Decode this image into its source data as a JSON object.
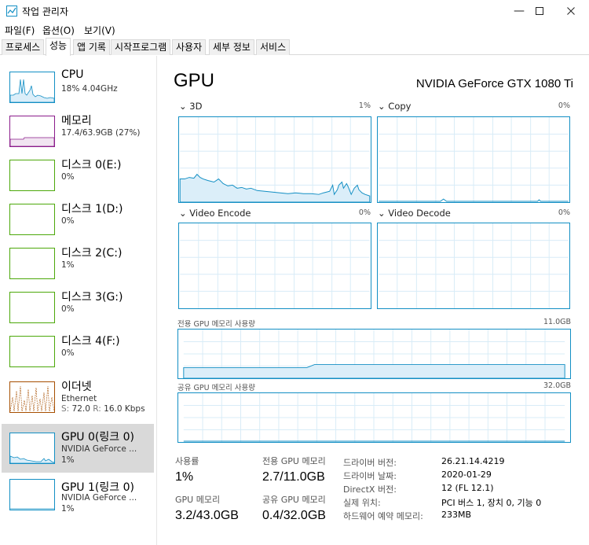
{
  "window": {
    "title": "작업 관리자"
  },
  "menu": [
    "파일(F)",
    "옵션(O)",
    "보기(V)"
  ],
  "tabs": [
    "프로세스",
    "성능",
    "앱 기록",
    "시작프로그램",
    "사용자",
    "세부 정보",
    "서비스"
  ],
  "sidebar": [
    {
      "name": "CPU",
      "sub": "18% 4.04GHz",
      "color": "#138fc4"
    },
    {
      "name": "메모리",
      "sub": "17.4/63.9GB (27%)",
      "color": "#8b1c8b"
    },
    {
      "name": "디스크 0(E:)",
      "sub": "0%",
      "color": "#4ca80a"
    },
    {
      "name": "디스크 1(D:)",
      "sub": "0%",
      "color": "#4ca80a"
    },
    {
      "name": "디스크 2(C:)",
      "sub": "1%",
      "color": "#4ca80a"
    },
    {
      "name": "디스크 3(G:)",
      "sub": "0%",
      "color": "#4ca80a"
    },
    {
      "name": "디스크 4(F:)",
      "sub": "0%",
      "color": "#4ca80a"
    },
    {
      "name": "이더넷",
      "sub": "Ethernet",
      "sub2_s": "S:",
      "sub2_s_val": "72.0",
      "sub2_r": "R:",
      "sub2_r_val": "16.0 Kbps",
      "color": "#a74f01"
    },
    {
      "name": "GPU 0(링크 0)",
      "sub": "NVIDIA GeForce ...",
      "sub2": "1%",
      "color": "#138fc4"
    },
    {
      "name": "GPU 1(링크 0)",
      "sub": "NVIDIA GeForce ...",
      "sub2": "1%",
      "color": "#138fc4"
    }
  ],
  "main": {
    "title": "GPU",
    "model": "NVIDIA GeForce GTX 1080 Ti",
    "engines": [
      {
        "label": "3D",
        "pct": "1%"
      },
      {
        "label": "Copy",
        "pct": "0%"
      },
      {
        "label": "Video Encode",
        "pct": "0%"
      },
      {
        "label": "Video Decode",
        "pct": "0%"
      }
    ],
    "dedicated_label": "전용 GPU 메모리 사용량",
    "dedicated_max": "11.0GB",
    "shared_label": "공유 GPU 메모리 사용량",
    "shared_max": "32.0GB",
    "stats": {
      "usage_label": "사용률",
      "usage_val": "1%",
      "gpumem_label": "GPU 메모리",
      "gpumem_val": "3.2/43.0GB",
      "dedicated_label": "전용 GPU 메모리",
      "dedicated_val": "2.7/11.0GB",
      "shared_label": "공유 GPU 메모리",
      "shared_val": "0.4/32.0GB"
    },
    "info": [
      {
        "key": "드라이버 버전:",
        "val": "26.21.14.4219"
      },
      {
        "key": "드라이버 날짜:",
        "val": "2020-01-29"
      },
      {
        "key": "DirectX 버전:",
        "val": "12 (FL 12.1)"
      },
      {
        "key": "실제 위치:",
        "val": "PCI 버스 1, 장치 0, 기능 0"
      },
      {
        "key": "하드웨어 예약 메모리:",
        "val": "233MB"
      }
    ]
  }
}
